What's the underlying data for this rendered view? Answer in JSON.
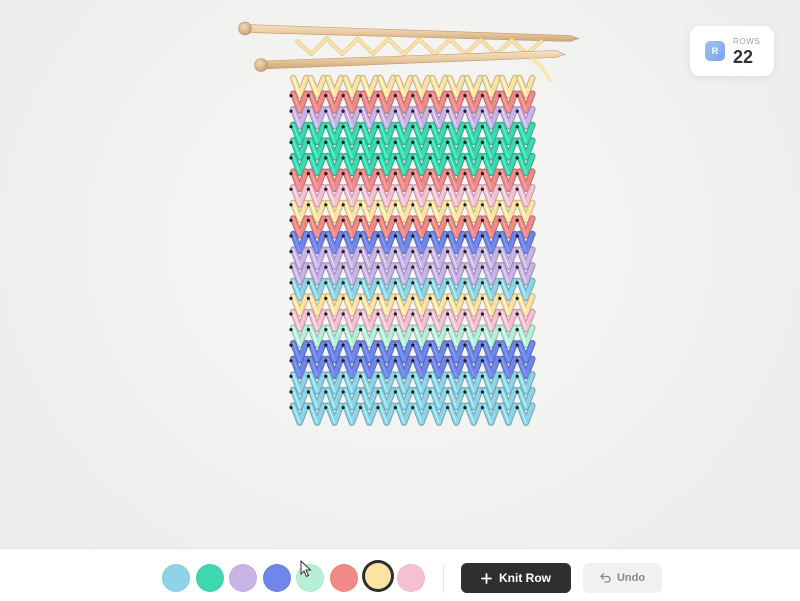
{
  "counter": {
    "badge_letter": "R",
    "label": "ROWS",
    "value": "22"
  },
  "palette": [
    {
      "name": "sky",
      "color": "#8fd3e6"
    },
    {
      "name": "teal",
      "color": "#3fd7b0"
    },
    {
      "name": "lavender",
      "color": "#c8b3e6"
    },
    {
      "name": "blue",
      "color": "#6f86ea"
    },
    {
      "name": "mint",
      "color": "#b6efd6"
    },
    {
      "name": "coral",
      "color": "#f08a88"
    },
    {
      "name": "butter",
      "color": "#fde2a6"
    },
    {
      "name": "pink",
      "color": "#f7bfd2"
    }
  ],
  "selected_color": "butter",
  "knitting": {
    "stitches_per_row": 14,
    "rows": [
      "butter",
      "coral",
      "lavender",
      "teal",
      "teal",
      "teal",
      "coral",
      "pink",
      "butter",
      "coral",
      "blue",
      "lavender",
      "lavender",
      "sky",
      "butter",
      "pink",
      "mint",
      "blue",
      "blue",
      "sky",
      "sky",
      "sky"
    ]
  },
  "actions": {
    "knit_row_label": "Knit Row",
    "knit_row_icon": "plus-icon",
    "undo_label": "Undo",
    "undo_icon": "undo-arrow-icon"
  }
}
